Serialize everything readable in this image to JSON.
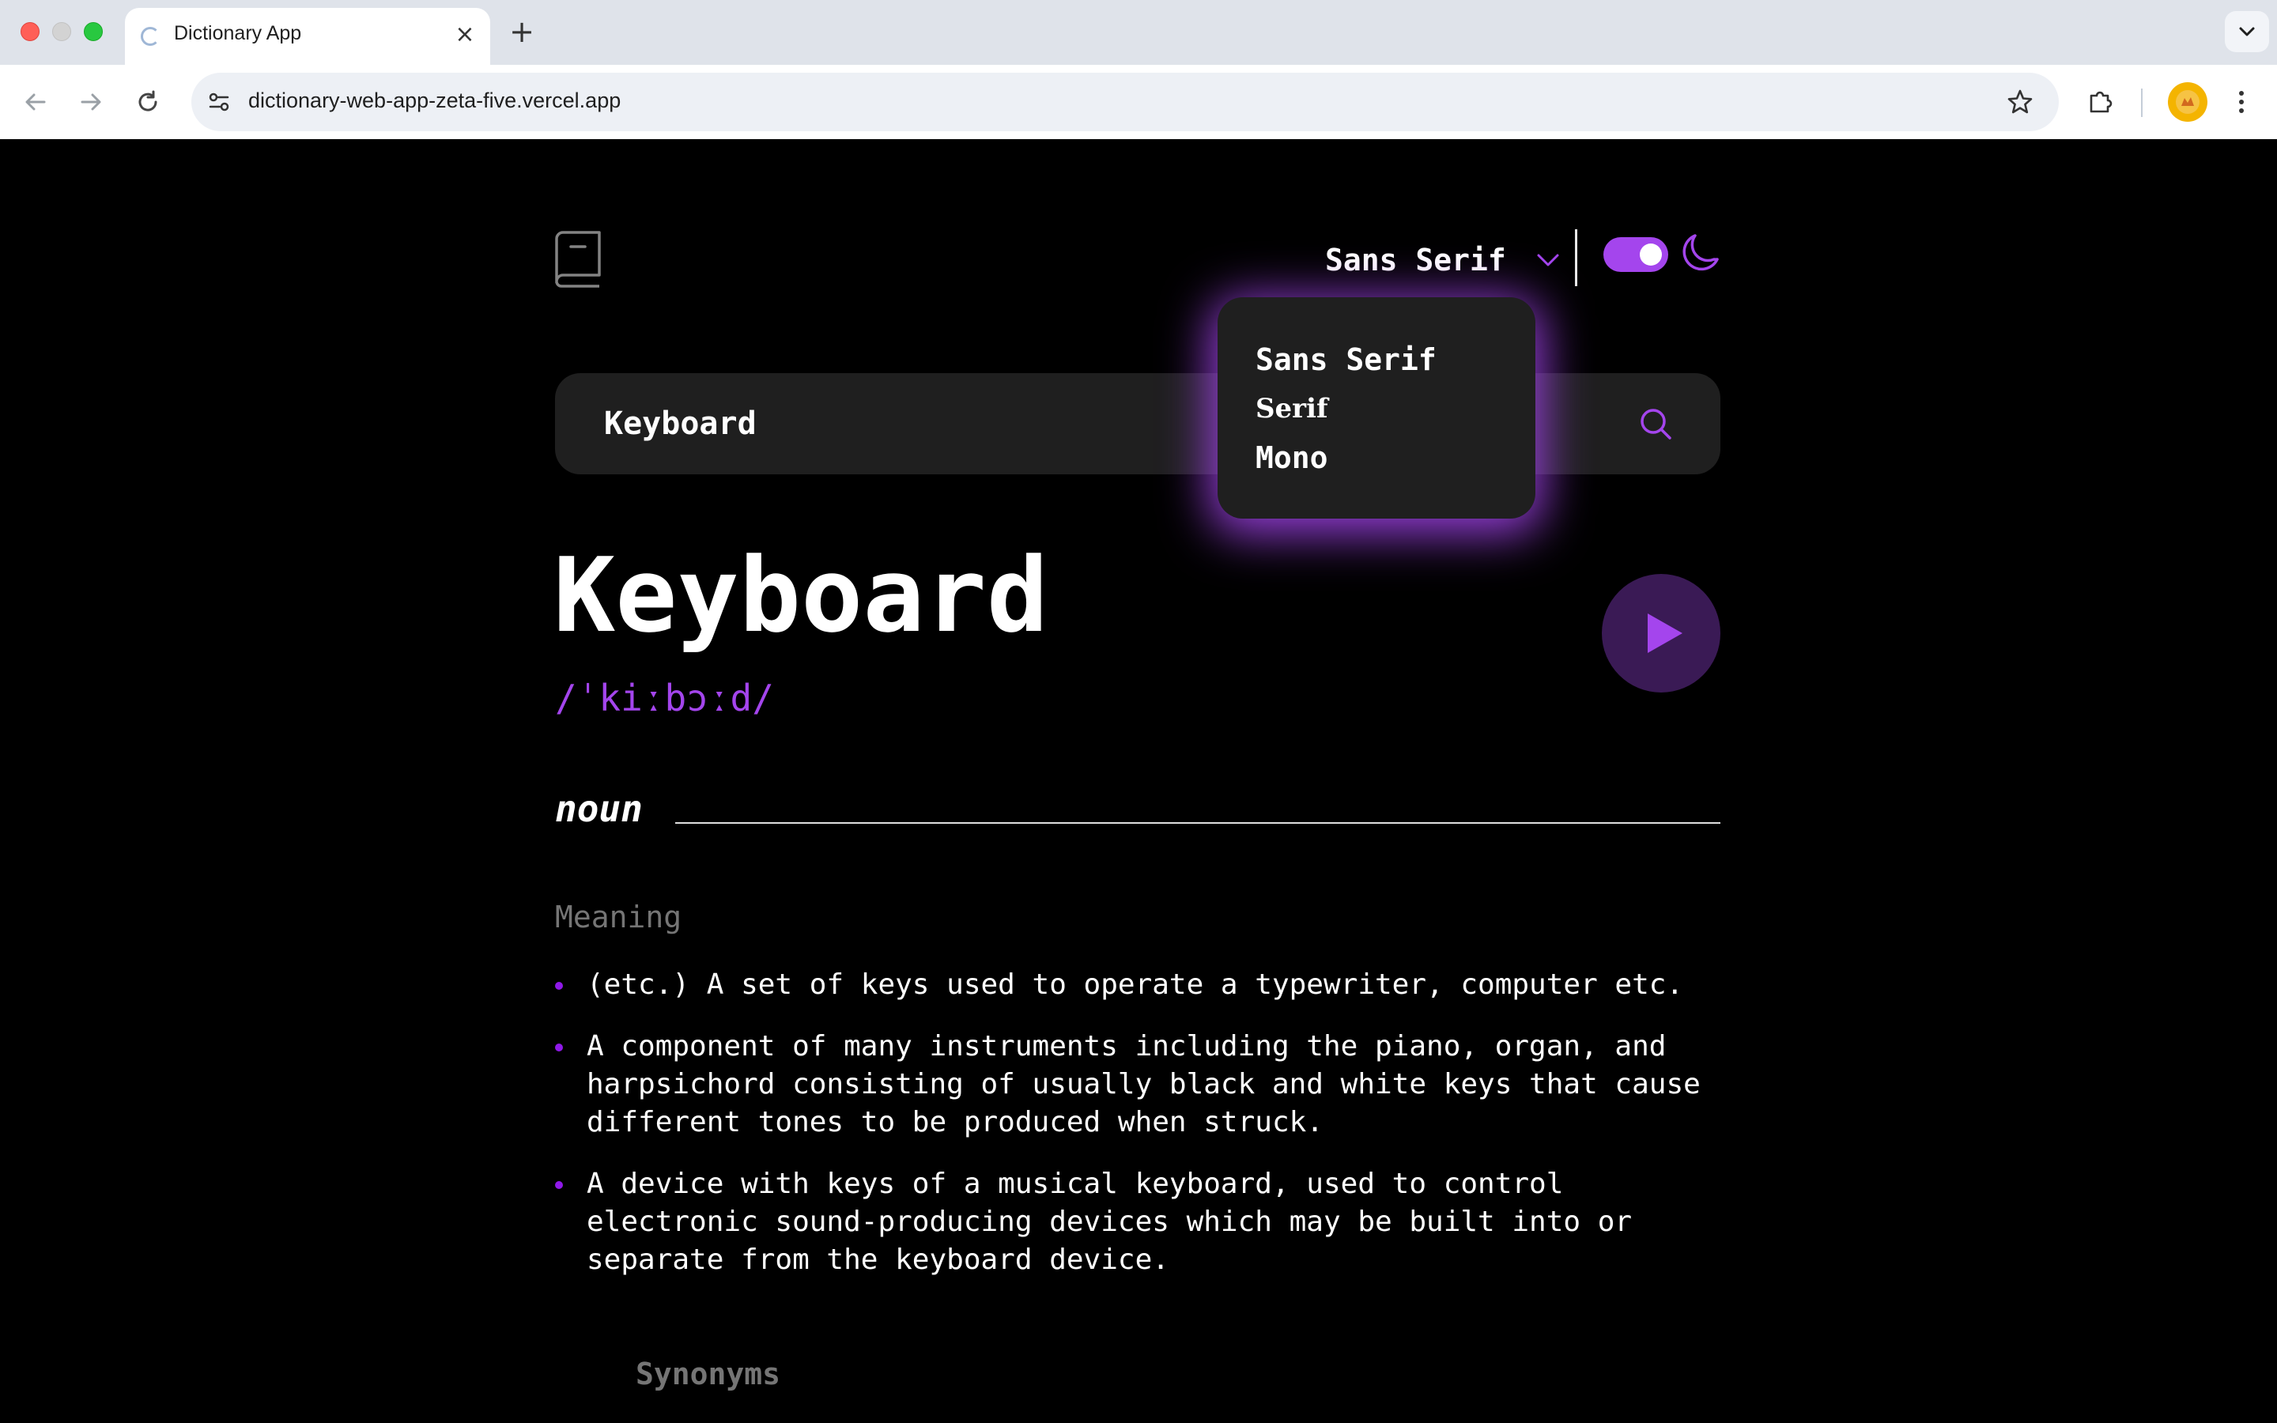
{
  "browser": {
    "tab_title": "Dictionary App",
    "tab_close": "×",
    "new_tab": "+",
    "url": "dictionary-web-app-zeta-five.vercel.app"
  },
  "header": {
    "font_select": {
      "selected": "Sans Serif"
    },
    "theme": {
      "dark_mode": true,
      "accent": "#a445ed"
    }
  },
  "font_dropdown": {
    "open": true,
    "options": [
      "Sans Serif",
      "Serif",
      "Mono"
    ]
  },
  "search": {
    "value": "Keyboard"
  },
  "entry": {
    "word": "Keyboard",
    "phonetic": "/ˈkiːbɔːd/",
    "part_of_speech": "noun",
    "meaning_heading": "Meaning",
    "meanings": [
      "(etc.) A set of keys used to operate a typewriter, computer etc.",
      "A component of many instruments including the piano, organ, and harpsichord consisting of usually black and white keys that cause different tones to be produced when struck.",
      "A device with keys of a musical keyboard, used to control electronic sound-producing devices which may be built into or separate from the keyboard device."
    ],
    "synonyms_heading": "Synonyms"
  },
  "colors": {
    "page_bg": "#000000",
    "surface": "#1f1f1f",
    "accent": "#a445ed",
    "muted": "#757575"
  }
}
